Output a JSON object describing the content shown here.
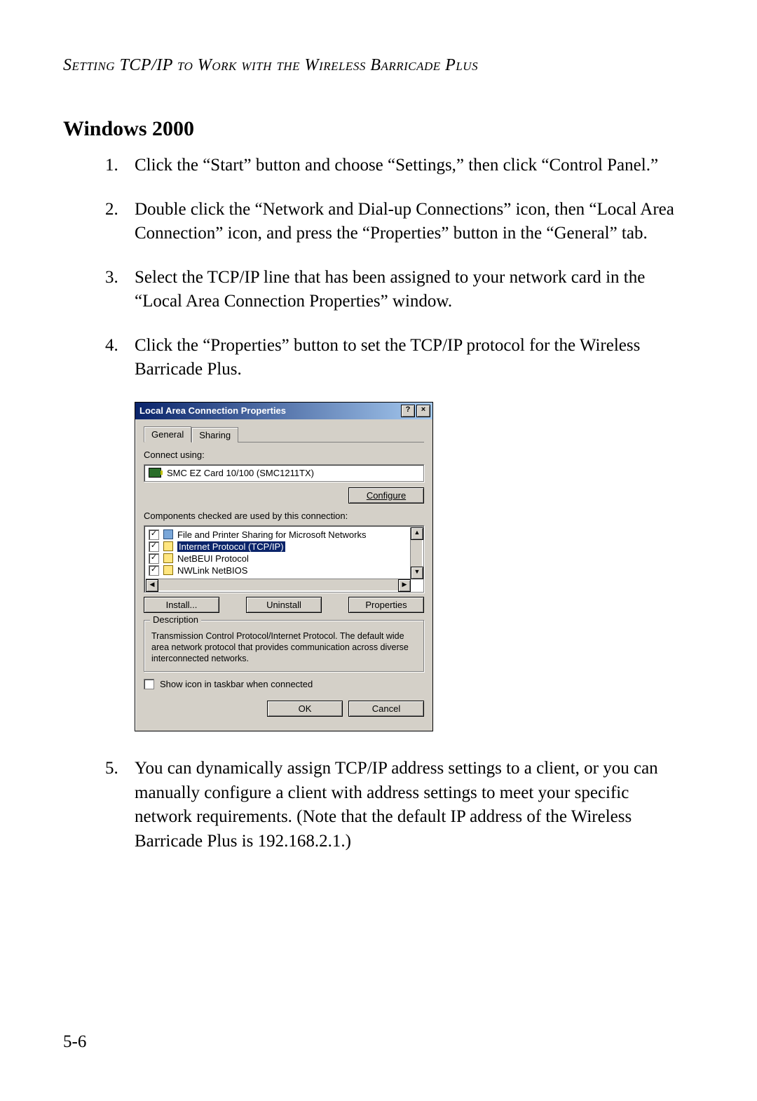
{
  "running_head": "Setting TCP/IP to Work with the Wireless Barricade Plus",
  "heading": "Windows 2000",
  "steps": [
    "Click the “Start” button and choose “Settings,” then click “Control Panel.”",
    "Double click the “Network and Dial-up Connections” icon, then “Local Area Connection” icon, and press the “Properties” button in the “General” tab.",
    "Select the TCP/IP line that has been assigned to your network card in the “Local Area Connection Properties” window.",
    "Click the “Properties” button to set the TCP/IP protocol for the Wireless Barricade Plus.",
    "You can dynamically assign TCP/IP address settings to a client, or you can manually configure a client with address settings to meet your specific network requirements. (Note that the default IP address of the Wireless Barricade Plus is 192.168.2.1.)"
  ],
  "page_number": "5-6",
  "dialog": {
    "title": "Local Area Connection Properties",
    "help_glyph": "?",
    "close_glyph": "×",
    "tabs": {
      "general": "General",
      "sharing": "Sharing"
    },
    "connect_using_label": "Connect using:",
    "adapter": "SMC EZ Card 10/100 (SMC1211TX)",
    "configure_btn": "Configure",
    "components_label": "Components checked are used by this connection:",
    "components": [
      {
        "checked": true,
        "icon": "share",
        "label": "File and Printer Sharing for Microsoft Networks",
        "selected": false
      },
      {
        "checked": true,
        "icon": "net",
        "label": "Internet Protocol (TCP/IP)",
        "selected": true
      },
      {
        "checked": true,
        "icon": "net",
        "label": "NetBEUI Protocol",
        "selected": false
      },
      {
        "checked": true,
        "icon": "net",
        "label": "NWLink NetBIOS",
        "selected": false
      }
    ],
    "scroll": {
      "up": "▲",
      "down": "▼",
      "left": "◀",
      "right": "▶"
    },
    "install_btn": "Install...",
    "uninstall_btn": "Uninstall",
    "properties_btn": "Properties",
    "description_legend": "Description",
    "description_text": "Transmission Control Protocol/Internet Protocol. The default wide area network protocol that provides communication across diverse interconnected networks.",
    "show_icon_label": "Show icon in taskbar when connected",
    "ok_btn": "OK",
    "cancel_btn": "Cancel"
  }
}
